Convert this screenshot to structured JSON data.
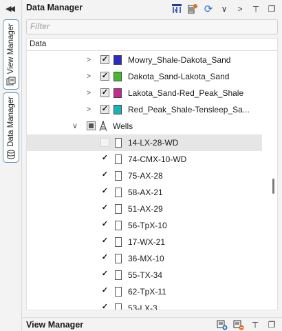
{
  "sidebar": {
    "collapse_glyph": "◀◀",
    "tabs": [
      {
        "label": "View Manager",
        "icon": "views-icon"
      },
      {
        "label": "Data Manager",
        "icon": "database-icon"
      }
    ]
  },
  "data_manager": {
    "title": "Data Manager",
    "toolbar": {
      "refresh_glyph": "⟳",
      "dropdown_glyph": "∨",
      "next_glyph": ">",
      "pin_glyph": "⊥",
      "float_glyph": "❐"
    },
    "filter": {
      "placeholder": "Filter",
      "value": ""
    },
    "column_header": "Data",
    "chevron_glyphs": {
      "collapsed": ">",
      "expanded": "∨"
    },
    "checkmark": "✓",
    "rows": [
      {
        "label": "Mowry_Shale-Dakota_Sand",
        "checked": true,
        "expanded": false,
        "swatch": "#2a2dc0",
        "kind": "surface"
      },
      {
        "label": "Dakota_Sand-Lakota_Sand",
        "checked": true,
        "expanded": false,
        "swatch": "#46b92e",
        "kind": "surface"
      },
      {
        "label": "Lakota_Sand-Red_Peak_Shale",
        "checked": true,
        "expanded": false,
        "swatch": "#c42991",
        "kind": "surface"
      },
      {
        "label": "Red_Peak_Shale-Tensleep_Sa...",
        "checked": true,
        "expanded": false,
        "swatch": "#19b0b8",
        "kind": "surface"
      },
      {
        "label": "Wells",
        "checked": "partial",
        "expanded": true,
        "kind": "folder"
      },
      {
        "label": "14-LX-28-WD",
        "checked": false,
        "selected": true,
        "kind": "well"
      },
      {
        "label": "74-CMX-10-WD",
        "checked": true,
        "kind": "well"
      },
      {
        "label": "75-AX-28",
        "checked": true,
        "kind": "well"
      },
      {
        "label": "58-AX-21",
        "checked": true,
        "kind": "well"
      },
      {
        "label": "51-AX-29",
        "checked": true,
        "kind": "well"
      },
      {
        "label": "56-TpX-10",
        "checked": true,
        "kind": "well"
      },
      {
        "label": "17-WX-21",
        "checked": true,
        "kind": "well"
      },
      {
        "label": "36-MX-10",
        "checked": true,
        "kind": "well"
      },
      {
        "label": "55-TX-34",
        "checked": true,
        "kind": "well"
      },
      {
        "label": "62-TpX-11",
        "checked": true,
        "kind": "well"
      },
      {
        "label": "53-LX-3",
        "checked": true,
        "kind": "well"
      }
    ]
  },
  "view_manager": {
    "title": "View Manager",
    "pin_glyph": "⊥",
    "float_glyph": "❐"
  }
}
